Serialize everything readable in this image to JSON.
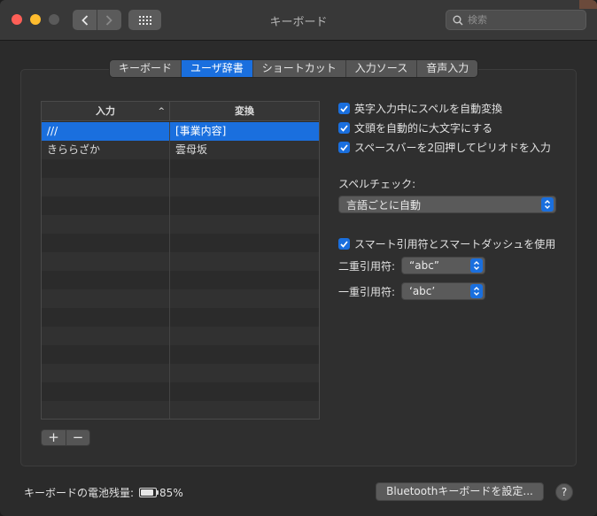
{
  "window": {
    "title": "キーボード"
  },
  "search": {
    "placeholder": "検索"
  },
  "tabs": [
    {
      "label": "キーボード",
      "active": false
    },
    {
      "label": "ユーザ辞書",
      "active": true
    },
    {
      "label": "ショートカット",
      "active": false
    },
    {
      "label": "入力ソース",
      "active": false
    },
    {
      "label": "音声入力",
      "active": false
    }
  ],
  "table": {
    "columns": [
      "入力",
      "変換"
    ],
    "rows": [
      {
        "input": "///",
        "output": "[事業内容]",
        "selected": true
      },
      {
        "input": "きららざか",
        "output": "雲母坂",
        "selected": false
      }
    ],
    "empty_rows": 14
  },
  "controls": {
    "add_label": "+",
    "remove_label": "−"
  },
  "options": {
    "auto_correct": "英字入力中にスペルを自動変換",
    "auto_capitalize": "文頭を自動的に大文字にする",
    "double_space_period": "スペースバーを2回押してピリオドを入力",
    "spell_check_label": "スペルチェック:",
    "spell_check_value": "言語ごとに自動",
    "smart_quotes": "スマート引用符とスマートダッシュを使用",
    "double_quote_label": "二重引用符:",
    "double_quote_value": "“abc”",
    "single_quote_label": "一重引用符:",
    "single_quote_value": "‘abc’"
  },
  "footer": {
    "battery_label": "キーボードの電池残量:",
    "battery_level": 0.85,
    "battery_text": "85%",
    "bluetooth_button": "Bluetoothキーボードを設定...",
    "help": "?"
  },
  "colors": {
    "accent": "#1a6fde"
  }
}
